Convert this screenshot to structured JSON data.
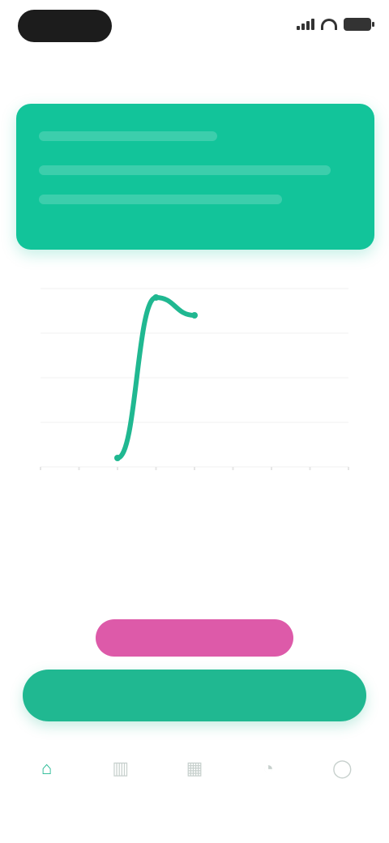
{
  "status_bar": {
    "time": "",
    "icons": [
      "signal-icon",
      "wifi-icon",
      "battery-icon"
    ]
  },
  "header": {
    "title": ""
  },
  "hero": {
    "title": "",
    "subtitle": ""
  },
  "chart_data": {
    "type": "line",
    "title": "",
    "x": [
      0,
      1,
      2,
      3,
      4,
      5,
      6,
      7,
      8
    ],
    "series": [
      {
        "values": [
          null,
          null,
          0.5,
          9.5,
          8.5,
          null,
          null,
          null,
          null
        ]
      }
    ],
    "ylim": [
      0,
      10
    ],
    "grid": true,
    "colors": {
      "line": "#20b891",
      "grid": "#f0f0f0"
    }
  },
  "cta": {
    "headline": "",
    "subtext": ""
  },
  "buttons": {
    "pink_label": "",
    "primary_label": ""
  },
  "tabs": [
    {
      "label": "",
      "icon": "home-icon",
      "active": true
    },
    {
      "label": "",
      "icon": "chart-icon",
      "active": false
    },
    {
      "label": "",
      "icon": "calendar-icon",
      "active": false
    },
    {
      "label": "",
      "icon": "bell-icon",
      "active": false
    },
    {
      "label": "",
      "icon": "user-icon",
      "active": false
    }
  ],
  "colors": {
    "accent": "#12c49a",
    "button": "#20b891",
    "pink": "#dd5aa9"
  }
}
